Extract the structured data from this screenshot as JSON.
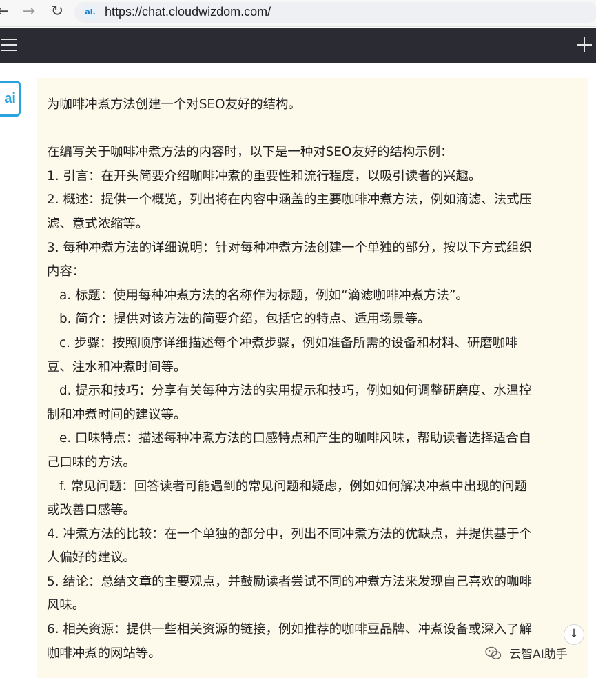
{
  "browser": {
    "back_icon": "←",
    "forward_icon": "→",
    "reload_icon": "↻",
    "site_icon_text": "ai.",
    "url": "https://chat.cloudwizdom.com/"
  },
  "header": {
    "menu_icon": "hamburger-icon",
    "new_chat_icon": "plus-icon"
  },
  "avatar": {
    "text": "ai"
  },
  "message": {
    "title": "为咖啡冲煮方法创建一个对SEO友好的结构。",
    "lines": [
      "在编写关于咖啡冲煮方法的内容时，以下是一种对SEO友好的结构示例：",
      "1. 引言：在开头简要介绍咖啡冲煮的重要性和流行程度，以吸引读者的兴趣。",
      "2. 概述：提供一个概览，列出将在内容中涵盖的主要咖啡冲煮方法，例如滴滤、法式压",
      "滤、意式浓缩等。",
      "3. 每种冲煮方法的详细说明：针对每种冲煮方法创建一个单独的部分，按以下方式组织",
      "内容：",
      "a. 标题：使用每种冲煮方法的名称作为标题，例如“滴滤咖啡冲煮方法”。",
      "b. 简介：提供对该方法的简要介绍，包括它的特点、适用场景等。",
      "c. 步骤：按照顺序详细描述每个冲煮步骤，例如准备所需的设备和材料、研磨咖啡",
      "豆、注水和冲煮时间等。",
      "d. 提示和技巧：分享有关每种方法的实用提示和技巧，例如如何调整研磨度、水温控",
      "制和冲煮时间的建议等。",
      "e. 口味特点：描述每种冲煮方法的口感特点和产生的咖啡风味，帮助读者选择适合自",
      "己口味的方法。",
      "f. 常见问题：回答读者可能遇到的常见问题和疑虑，例如如何解决冲煮中出现的问题",
      "或改善口感等。",
      "4. 冲煮方法的比较：在一个单独的部分中，列出不同冲煮方法的优缺点，并提供基于个",
      "人偏好的建议。",
      "5. 结论：总结文章的主要观点，并鼓励读者尝试不同的冲煮方法来发现自己喜欢的咖啡",
      "风味。",
      "6. 相关资源：提供一些相关资源的链接，例如推荐的咖啡豆品牌、冲煮设备或深入了解",
      "咖啡冲煮的网站等。"
    ]
  },
  "scroll_button_icon": "↓",
  "watermark": {
    "text": "云智AI助手"
  },
  "colors": {
    "header_bg": "#2b2c33",
    "bubble_bg": "#fdfaeb",
    "accent": "#29a3e0"
  }
}
